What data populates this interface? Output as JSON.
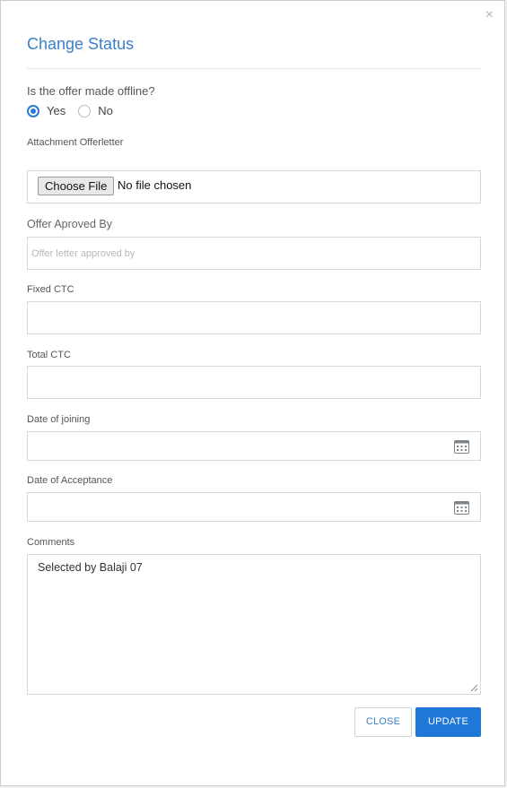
{
  "modal": {
    "title": "Change Status",
    "close_glyph": "×"
  },
  "offer_offline": {
    "question": "Is the offer made offline?",
    "options": [
      {
        "label": "Yes",
        "selected": true
      },
      {
        "label": "No",
        "selected": false
      }
    ]
  },
  "attachment": {
    "label": "Attachment Offerletter",
    "button_label": "Choose File",
    "status": "No file chosen"
  },
  "approved_by": {
    "label": "Offer Aproved By",
    "value": "",
    "placeholder": "Offer letter approved by"
  },
  "fixed_ctc": {
    "label": "Fixed CTC",
    "value": ""
  },
  "total_ctc": {
    "label": "Total CTC",
    "value": ""
  },
  "date_of_joining": {
    "label": "Date of joining",
    "value": "",
    "icon": "calendar-icon"
  },
  "date_of_acceptance": {
    "label": "Date of Acceptance",
    "value": "",
    "icon": "calendar-icon"
  },
  "comments": {
    "label": "Comments",
    "value": "Selected by Balaji 07"
  },
  "actions": {
    "close_label": "CLOSE",
    "update_label": "UPDATE"
  },
  "colors": {
    "accent": "#1f78d8",
    "title": "#3a7fc9"
  }
}
